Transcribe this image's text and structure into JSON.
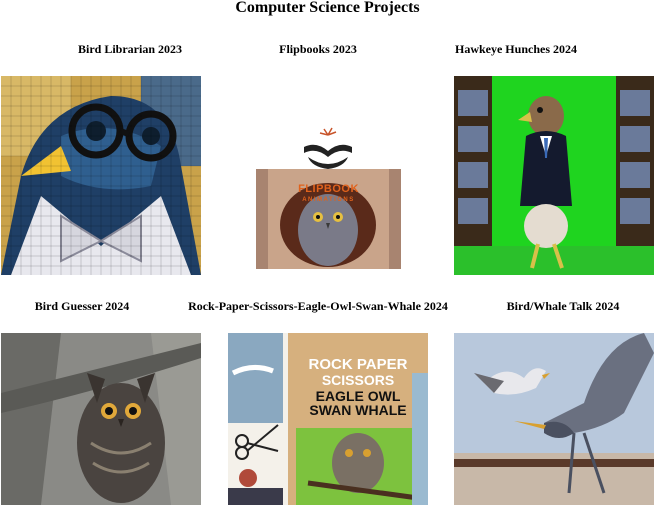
{
  "page": {
    "title": "Computer Science Projects"
  },
  "projects": [
    {
      "title": "Bird Librarian 2023",
      "image": "pixelated-bird-librarian-with-glasses"
    },
    {
      "title": "Flipbooks 2023",
      "image": "flipbook-animations-owl",
      "logo_text": "FLIPBOOK",
      "logo_subtext": "ANIMATIONS"
    },
    {
      "title": "Hawkeye Hunches 2024",
      "image": "hawk-in-suit-library"
    },
    {
      "title": "Bird Guesser 2024",
      "image": "great-horned-owl-in-tree"
    },
    {
      "title": "Rock-Paper-Scissors-Eagle-Owl-Swan-Whale 2024",
      "image": "rock-paper-scissors-collage",
      "poster_lines": [
        "ROCK PAPER",
        "SCISSORS",
        "EAGLE OWL",
        "SWAN WHALE"
      ]
    },
    {
      "title": "Bird/Whale Talk 2024",
      "image": "gulls-and-heron-in-flight"
    }
  ]
}
